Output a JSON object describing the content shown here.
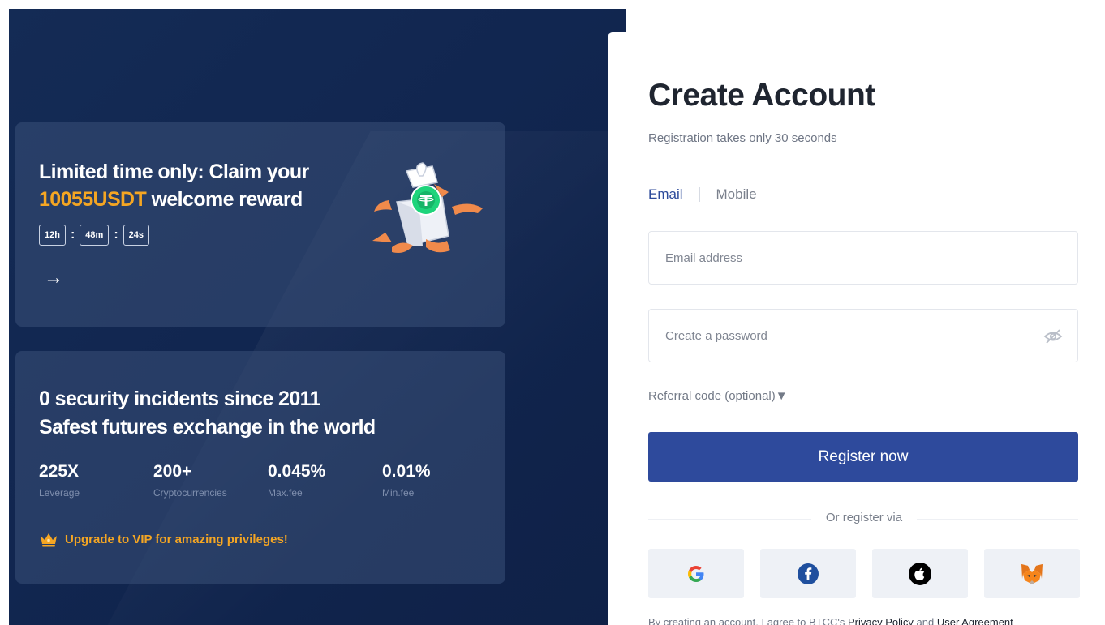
{
  "promo": {
    "title_prefix": "Limited time only: Claim your",
    "title_highlight": "10055USDT",
    "title_suffix": " welcome reward",
    "countdown": {
      "hours": "12h",
      "minutes": "48m",
      "seconds": "24s",
      "separator": ":"
    },
    "arrow": "→"
  },
  "stats": {
    "title_line1": "0 security incidents since 2011",
    "title_line2": "Safest futures exchange in the world",
    "items": [
      {
        "value": "225X",
        "label": "Leverage"
      },
      {
        "value": "200+",
        "label": "Cryptocurrencies"
      },
      {
        "value": "0.045%",
        "label": "Max.fee"
      },
      {
        "value": "0.01%",
        "label": "Min.fee"
      }
    ],
    "vip_text": "Upgrade to VIP for amazing privileges!"
  },
  "form": {
    "title": "Create Account",
    "subtitle": "Registration takes only 30 seconds",
    "tabs": [
      {
        "label": "Email",
        "active": true
      },
      {
        "label": "Mobile",
        "active": false
      }
    ],
    "email_placeholder": "Email address",
    "password_placeholder": "Create a password",
    "referral_label": "Referral code (optional)",
    "referral_arrow": "▼",
    "register_label": "Register now",
    "or_label": "Or register via",
    "social": [
      "google-icon",
      "facebook-icon",
      "apple-icon",
      "metamask-icon"
    ],
    "terms_prefix": "By creating an account, I agree to BTCC's ",
    "privacy_link": "Privacy Policy",
    "terms_and": " and ",
    "agreement_link": "User Agreement"
  },
  "colors": {
    "accent": "#2e4a9c",
    "highlight": "#f5a623",
    "panel_bg": "#112650"
  }
}
